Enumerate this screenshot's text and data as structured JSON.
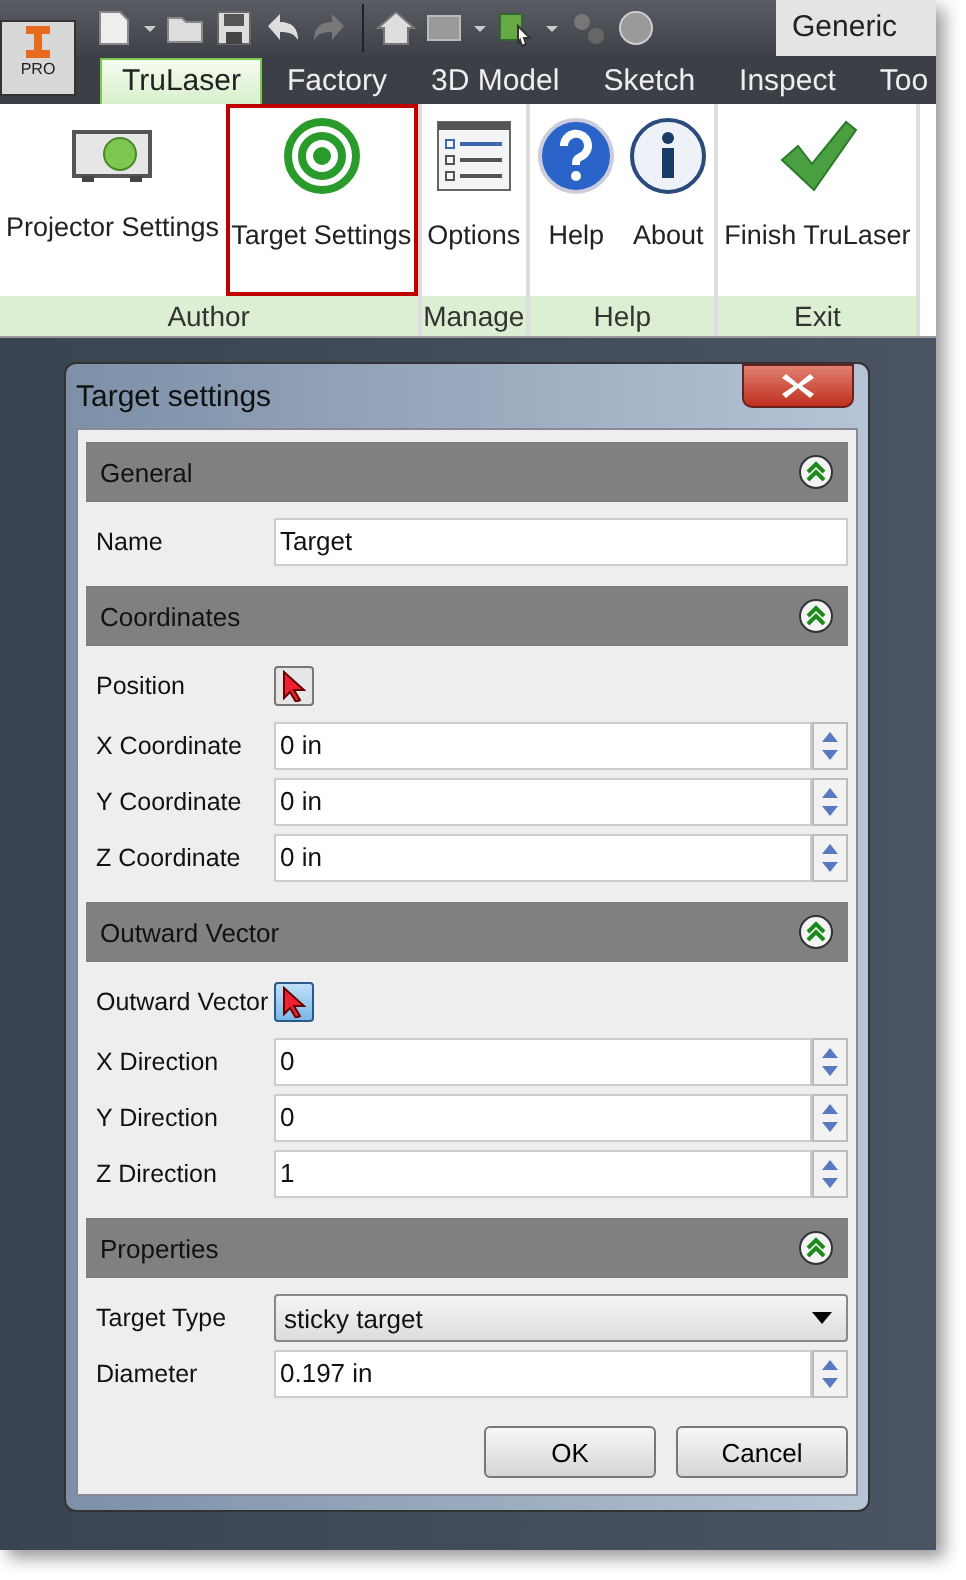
{
  "app_button": {
    "label": "PRO"
  },
  "workspace": "Generic",
  "tabs": [
    {
      "label": "TruLaser",
      "selected": true
    },
    {
      "label": "Factory",
      "selected": false
    },
    {
      "label": "3D Model",
      "selected": false
    },
    {
      "label": "Sketch",
      "selected": false
    },
    {
      "label": "Inspect",
      "selected": false
    },
    {
      "label": "Too",
      "selected": false
    }
  ],
  "ribbon_groups": [
    {
      "label": "Author",
      "buttons": [
        {
          "kind": "projector",
          "label": "Projector Settings",
          "highlighted": false
        },
        {
          "kind": "target",
          "label": "Target Settings",
          "highlighted": true
        }
      ]
    },
    {
      "label": "Manage",
      "buttons": [
        {
          "kind": "list",
          "label": "Options",
          "highlighted": false
        }
      ]
    },
    {
      "label": "Help",
      "buttons": [
        {
          "kind": "help",
          "label": "Help",
          "highlighted": false
        },
        {
          "kind": "info",
          "label": "About",
          "highlighted": false
        }
      ]
    },
    {
      "label": "Exit",
      "buttons": [
        {
          "kind": "check",
          "label": "Finish TruLaser",
          "highlighted": false
        }
      ]
    }
  ],
  "dialog": {
    "title": "Target settings",
    "sections": [
      {
        "title": "General",
        "expanded": true,
        "rows": [
          {
            "kind": "text",
            "label": "Name",
            "value": "Target"
          }
        ]
      },
      {
        "title": "Coordinates",
        "expanded": true,
        "rows": [
          {
            "kind": "pick",
            "label": "Position",
            "active": false
          },
          {
            "kind": "spin",
            "label": "X Coordinate",
            "value": "0 in"
          },
          {
            "kind": "spin",
            "label": "Y Coordinate",
            "value": "0 in"
          },
          {
            "kind": "spin",
            "label": "Z Coordinate",
            "value": "0 in"
          }
        ]
      },
      {
        "title": "Outward Vector",
        "expanded": true,
        "rows": [
          {
            "kind": "pick",
            "label": "Outward Vector",
            "active": true
          },
          {
            "kind": "spin",
            "label": "X Direction",
            "value": "0"
          },
          {
            "kind": "spin",
            "label": "Y Direction",
            "value": "0"
          },
          {
            "kind": "spin",
            "label": "Z Direction",
            "value": "1"
          }
        ]
      },
      {
        "title": "Properties",
        "expanded": true,
        "rows": [
          {
            "kind": "dropdown",
            "label": "Target Type",
            "value": "sticky target"
          },
          {
            "kind": "spin",
            "label": "Diameter",
            "value": "0.197 in"
          }
        ]
      }
    ],
    "buttons": [
      "OK",
      "Cancel"
    ]
  }
}
